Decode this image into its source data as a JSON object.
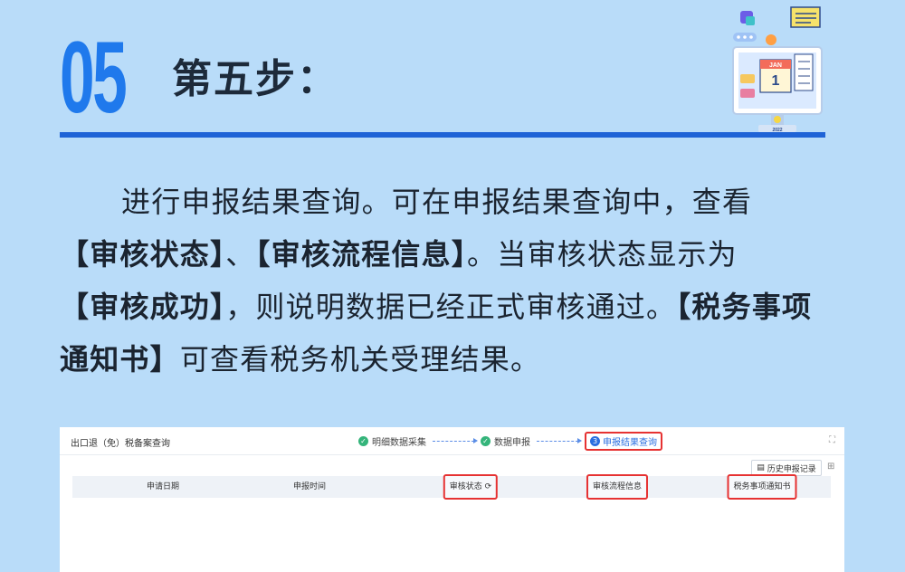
{
  "heading": {
    "number": "05",
    "title": "第五步："
  },
  "paragraph": {
    "s1": "进行申报结果查询。可在申报结果查询中，查看",
    "b1": "【审核状态】",
    "s2": "、",
    "b2": "【审核流程信息】",
    "s3": "。当审核状态显示为",
    "b3": "【审核成功】",
    "s4": "，则说明数据已经正式审核通过。",
    "b4": "【税务事项通知书】",
    "s5": "可查看税务机关受理结果。"
  },
  "illustration": {
    "calendar_month": "JAN",
    "calendar_day": "1",
    "year": "2022"
  },
  "app": {
    "title": "出口退（免）税备案查询",
    "steps": [
      {
        "label": "明细数据采集",
        "state": "done"
      },
      {
        "label": "数据申报",
        "state": "done"
      },
      {
        "number": "3",
        "label": "申报结果查询",
        "state": "current"
      }
    ],
    "history_button": "历史申报记录",
    "columns": [
      "申请日期",
      "申报时间",
      "审核状态",
      "审核流程信息",
      "税务事项通知书"
    ]
  },
  "colors": {
    "accent": "#1f79ec",
    "rule": "#1f63d6",
    "highlight": "#e63232",
    "background": "#b9dcf9"
  }
}
